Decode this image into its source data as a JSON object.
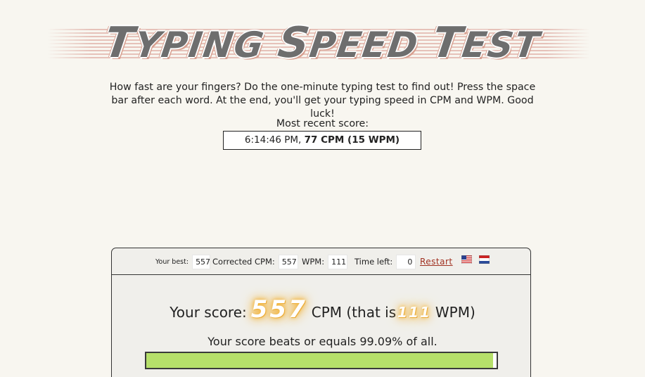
{
  "logo": {
    "text_small_1": "TYPING",
    "text_big_1": "S",
    "text_small_2": "PEED",
    "text_big_2": "T",
    "text_small_3": "EST"
  },
  "intro": {
    "text": "How fast are your fingers? Do the one-minute typing test to find out! Press the space bar after each word. At the end, you'll get your typing speed in CPM and WPM. Good luck!"
  },
  "recent": {
    "label": "Most recent score:",
    "time": "6:14:46 PM,",
    "score": "77 CPM (15 WPM)"
  },
  "stats": {
    "best_label": "Your best:",
    "best_value": "557",
    "corrected_label": "Corrected CPM:",
    "corrected_value": "557",
    "wpm_label": "WPM:",
    "wpm_value": "111",
    "time_label": "Time left:",
    "time_value": "0",
    "restart_label": "Restart"
  },
  "flags": [
    "us-flag-icon",
    "nl-flag-icon"
  ],
  "result": {
    "prefix": "Your score:",
    "cpm": "557",
    "middle": "CPM (that is",
    "wpm": "111",
    "suffix": "WPM)",
    "beats_text": "Your score beats or equals 99.09% of all.",
    "percentile": 99.09
  },
  "colors": {
    "background": "#f8f6f0",
    "panel": "#f0efeb",
    "bar_fill": "#b6e06a",
    "restart_link": "#a03020",
    "glow": "#f3b63a"
  }
}
